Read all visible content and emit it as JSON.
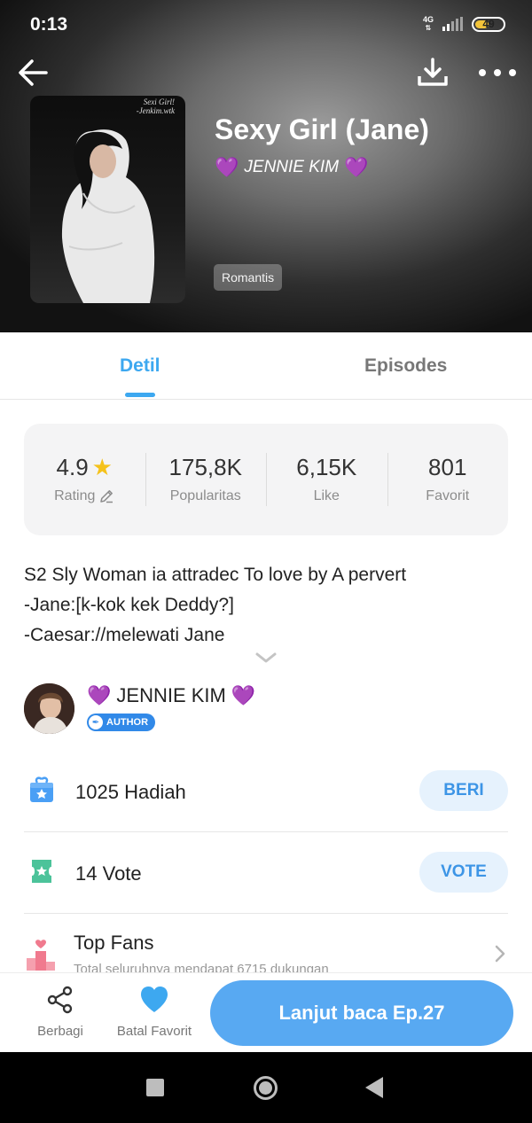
{
  "status_bar": {
    "time": "0:13",
    "network": "4G",
    "battery": "49",
    "battery_level": 0.49
  },
  "header": {
    "back_icon": "arrow-left-icon",
    "download_icon": "download-icon",
    "more_icon": "more-horizontal-icon",
    "cover_caption_line1": "Sexi Girl!",
    "cover_caption_line2": "-Jenkim.wtk",
    "title": "Sexy Girl (Jane)",
    "author": "JENNIE KIM",
    "heart": "💜",
    "genre": "Romantis"
  },
  "tabs": [
    {
      "label": "Detil",
      "active": true
    },
    {
      "label": "Episodes",
      "active": false
    }
  ],
  "stats": [
    {
      "value": "4.9",
      "label": "Rating",
      "icon": "star-icon"
    },
    {
      "value": "175,8K",
      "label": "Popularitas"
    },
    {
      "value": "6,15K",
      "label": "Like"
    },
    {
      "value": "801",
      "label": "Favorit"
    }
  ],
  "synopsis": {
    "line1": "S2 Sly Woman ia attradec To love by A pervert",
    "line2": "-Jane:[k-kok kek Deddy?]",
    "line3": "-Caesar://melewati Jane"
  },
  "author_section": {
    "name": "JENNIE KIM",
    "heart": "💜",
    "badge": "AUTHOR"
  },
  "gift": {
    "count": "1025",
    "label": "Hadiah",
    "button": "BERI"
  },
  "vote": {
    "count": "14",
    "label": "Vote",
    "button": "VOTE"
  },
  "top_fans": {
    "title": "Top Fans",
    "subtitle": "Total seluruhnya mendapat 6715 dukungan"
  },
  "bottom_bar": {
    "share_label": "Berbagi",
    "favorite_label": "Batal Favorit",
    "read_button": "Lanjut baca Ep.27"
  },
  "colors": {
    "accent": "#3da8f0",
    "button_blue": "#58a9f2",
    "heart_purple": "#8e24c7",
    "star": "#f5c21b",
    "gift_icon": "#4a9ff5",
    "vote_icon": "#4cc39a",
    "fans_icon": "#f07a8e"
  }
}
